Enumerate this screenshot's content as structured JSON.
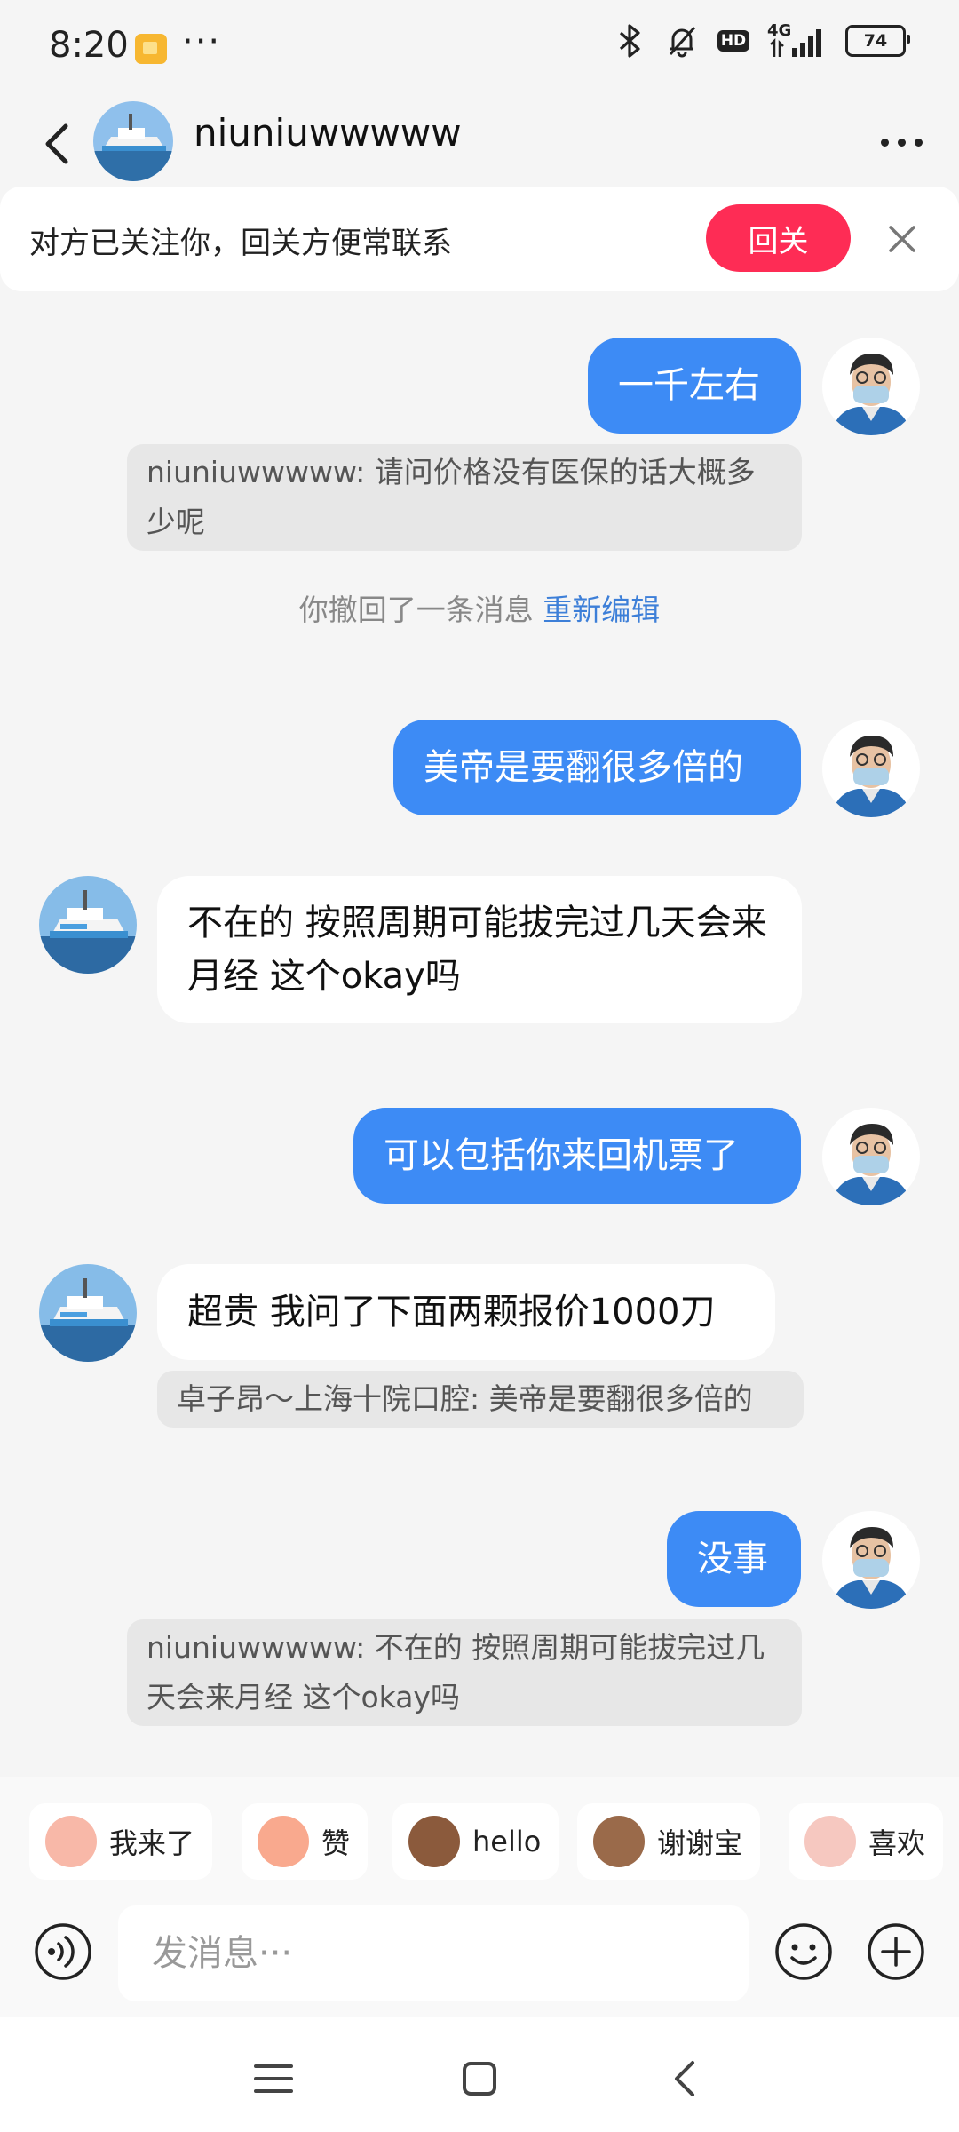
{
  "status_bar": {
    "time": "8:20",
    "dots": "···",
    "network": "4G",
    "hd": "HD",
    "battery": "74"
  },
  "header": {
    "name": "niuniuwwwww"
  },
  "banner": {
    "text": "对方已关注你，回关方便常联系",
    "follow_label": "回关"
  },
  "messages": {
    "m1": "一千左右",
    "q1": "niuniuwwwww: 请问价格没有医保的话大概多少呢",
    "recall_text": "你撤回了一条消息",
    "recall_edit": "重新编辑",
    "m2": "美帝是要翻很多倍的",
    "m3": "不在的 按照周期可能拔完过几天会来月经 这个okay吗",
    "m4": "可以包括你来回机票了",
    "m5": "超贵 我问了下面两颗报价1000刀",
    "q5": "卓子昂～上海十院口腔: 美帝是要翻很多倍的",
    "m6": "没事",
    "q6": "niuniuwwwww: 不在的 按照周期可能拔完过几天会来月经 这个okay吗"
  },
  "quick_replies": [
    "我来了",
    "赞",
    "hello",
    "谢谢宝",
    "喜欢"
  ],
  "input": {
    "placeholder": "发消息···"
  },
  "colors": {
    "my_bubble": "#3d8bf5",
    "follow_button": "#fe2c55",
    "edit_link": "#3d7fd8"
  }
}
